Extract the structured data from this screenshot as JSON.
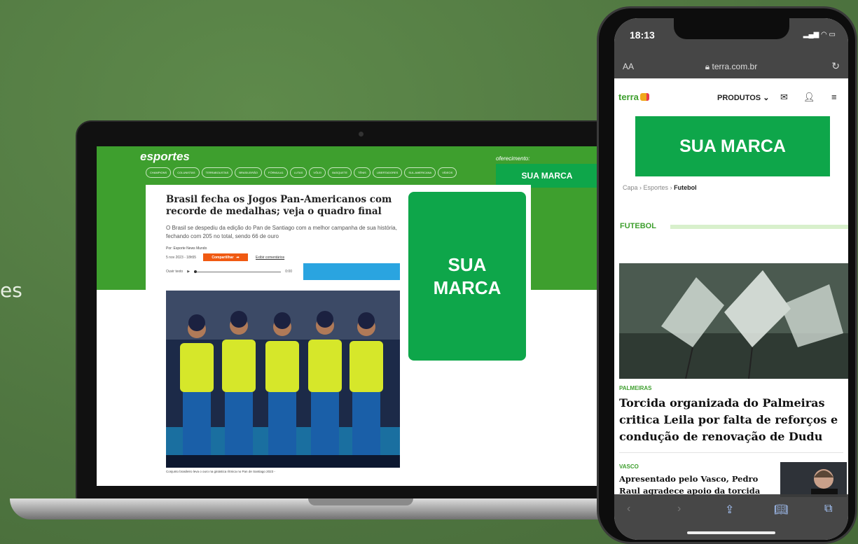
{
  "background": {
    "edge_text": "es"
  },
  "laptop": {
    "site_logo": "esportes",
    "nav": [
      "CHAMPIONS",
      "COLUNISTAS",
      "TERRABOLISTAS",
      "BRASILEIRÃO",
      "FÓRMULA1",
      "LUTAS",
      "VÔLEI",
      "BASQUETE",
      "TÊNIS",
      "LIBERTADORES",
      "SUL-AMERICANA",
      "VÍDEOS"
    ],
    "offered_by": "oferecimento:",
    "brand_small": "SUA MARCA",
    "article": {
      "title": "Brasil fecha os Jogos Pan-Americanos com recorde de medalhas; veja o quadro final",
      "subtitle": "O Brasil se despediu da edição do Pan de Santiago com a melhor campanha de sua história, fechando com 205 no total, sendo 66 de ouro",
      "author": "Por: Esporte News Mundo",
      "date": "5 nov 2023 - 18h55",
      "share_label": "Compartilhar",
      "comment_link": "Exibir comentários",
      "audio_label": "Ouvir texto",
      "audio_time": "0:00",
      "caption": "Conjunto brasileiro leva o ouro na ginástica rítmica no Pan de Santiago 2023 -"
    },
    "brand_big_line1": "SUA",
    "brand_big_line2": "MARCA"
  },
  "phone": {
    "time": "18:13",
    "url": "terra.com.br",
    "aa": "AA",
    "logo": "terra",
    "produtos": "PRODUTOS",
    "brand": "SUA MARCA",
    "breadcrumb": [
      "Capa",
      "Esportes",
      "Futebol"
    ],
    "section": "FUTEBOL",
    "story1": {
      "tag": "PALMEIRAS",
      "headline": "Torcida organizada do Palmeiras critica Leila por falta de reforços e condução de renovação de Dudu"
    },
    "story2": {
      "tag": "VASCO",
      "headline": "Apresentado pelo Vasco, Pedro Raul agradece apoio da torcida"
    }
  },
  "colors": {
    "brand_green": "#0ea64a",
    "site_green": "#3e9f2e",
    "background": "#557b43",
    "share_orange": "#f05a12"
  }
}
